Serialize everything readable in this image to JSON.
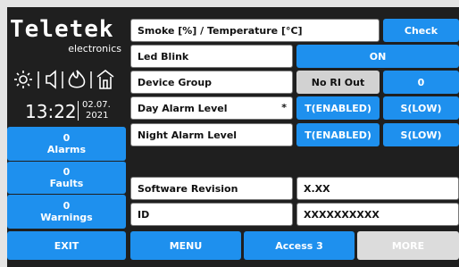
{
  "brand": {
    "name": "Teletek",
    "subtitle": "electronics"
  },
  "status": {
    "time": "13:22",
    "date_line1": "02.07.",
    "date_line2": "2021"
  },
  "sidebar": {
    "alarms": {
      "count": "0",
      "label": "Alarms"
    },
    "faults": {
      "count": "0",
      "label": "Faults"
    },
    "warnings": {
      "count": "0",
      "label": "Warnings"
    }
  },
  "rows": {
    "smoke": {
      "label": "Smoke [%] / Temperature [°C]",
      "action": "Check"
    },
    "led": {
      "label": "Led Blink",
      "value": "ON"
    },
    "group": {
      "label": "Device Group",
      "value": "No RI Out",
      "value2": "0"
    },
    "day": {
      "label": "Day Alarm Level",
      "marker": "*",
      "value": "T(ENABLED)",
      "value2": "S(LOW)"
    },
    "night": {
      "label": "Night Alarm Level",
      "value": "T(ENABLED)",
      "value2": "S(LOW)"
    },
    "software": {
      "label": "Software Revision",
      "value": "X.XX"
    },
    "id": {
      "label": "ID",
      "value": "XXXXXXXXXX"
    }
  },
  "footer": {
    "exit": "EXIT",
    "menu": "MENU",
    "access": "Access 3",
    "more": "MORE"
  },
  "colors": {
    "accent": "#1e90ee",
    "background": "#1f1f1f",
    "disabled": "#dcdcdc"
  }
}
